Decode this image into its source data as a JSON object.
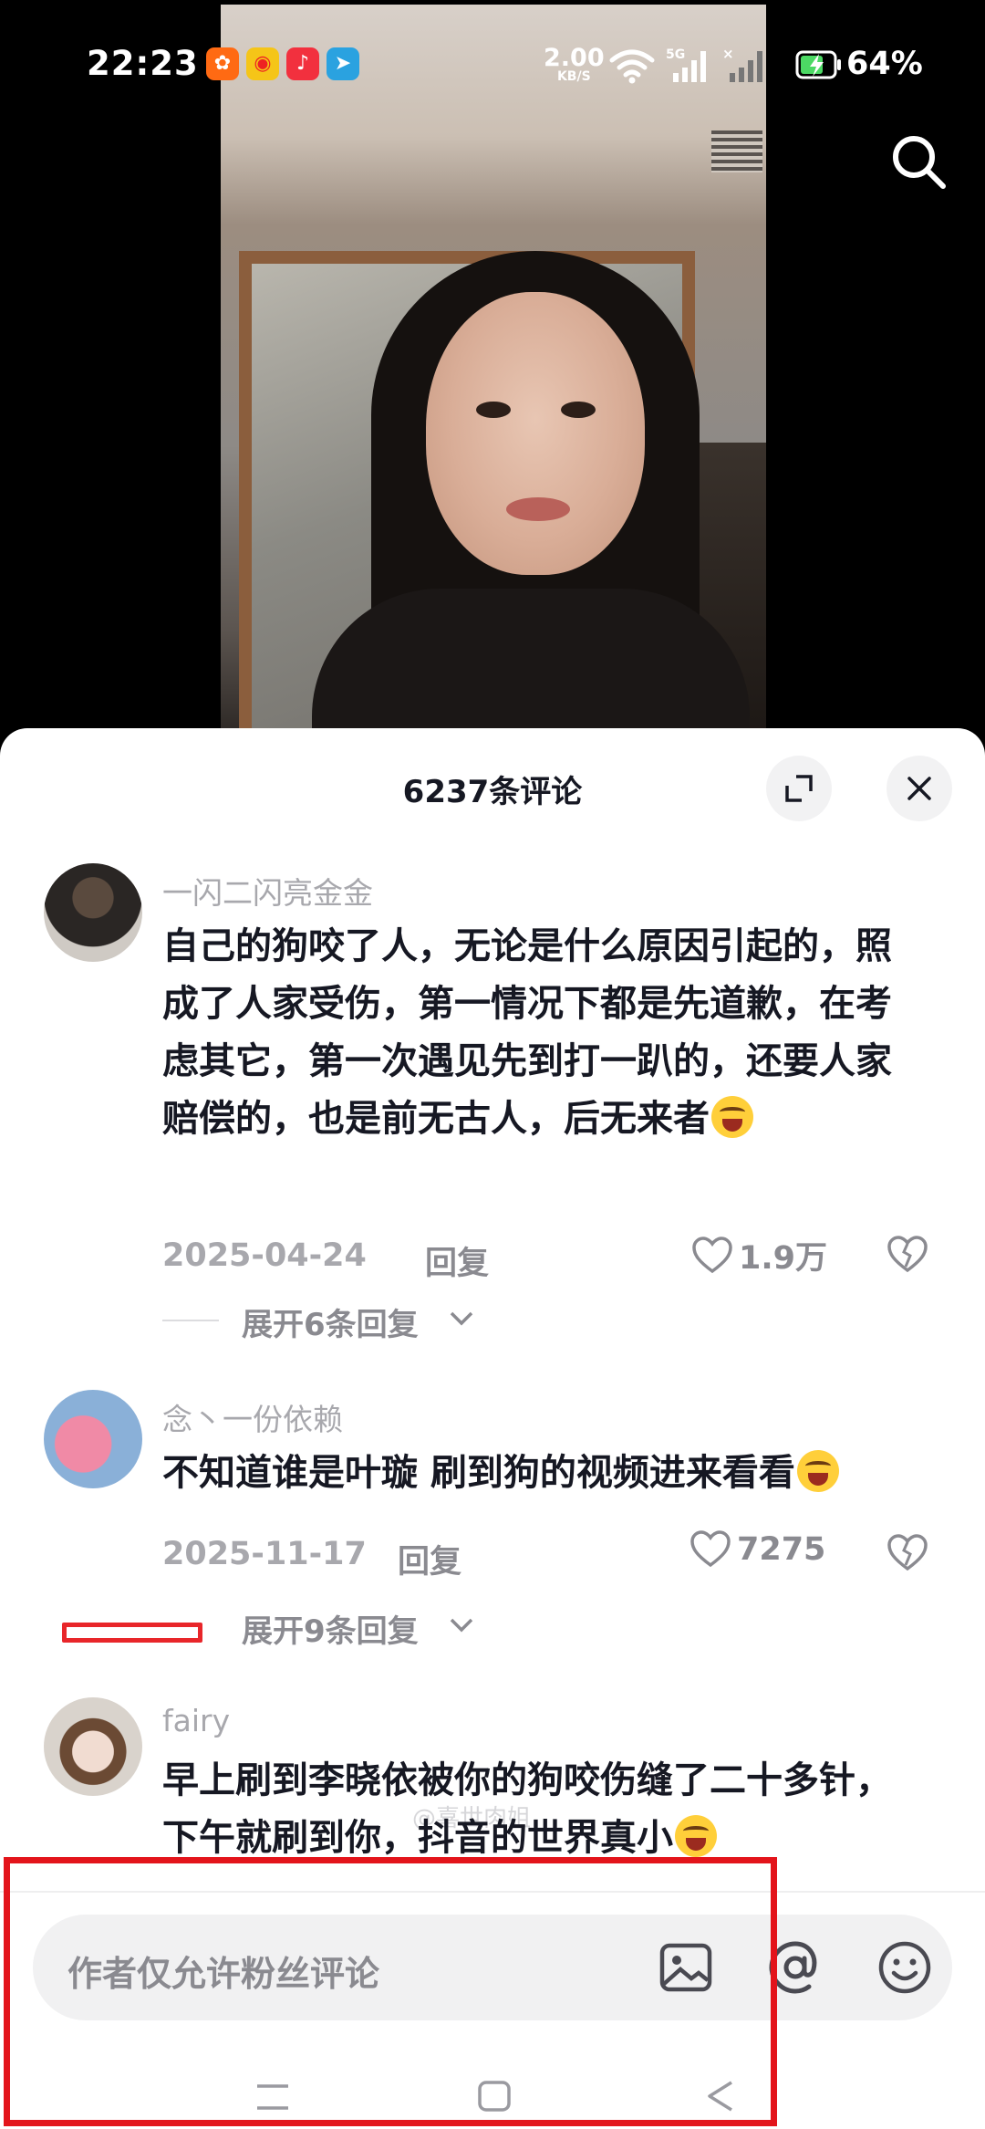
{
  "status_bar": {
    "time": "22:23",
    "net_speed_value": "2.00",
    "net_speed_unit": "KB/S",
    "network_type": "5G",
    "battery_percent": "64%",
    "app_icons": [
      "taobao-icon",
      "weibo-icon",
      "music-icon",
      "telegram-icon"
    ]
  },
  "comments_panel": {
    "title": "6237条评论",
    "watermark": "@喜世肉姐",
    "comments": [
      {
        "username": "一闪二闪亮金金",
        "text": "自己的狗咬了人，无论是什么原因引起的，照成了人家受伤，第一情况下都是先道歉，在考虑其它，第一次遇见先到打一趴的，还要人家赔偿的，也是前无古人，后无来者",
        "date": "2025-04-24",
        "reply_label": "回复",
        "likes": "1.9万",
        "expand_label": "展开6条回复"
      },
      {
        "username": "念丶一份依赖",
        "text": "不知道谁是叶璇 刷到狗的视频进来看看",
        "date": "2025-11-17",
        "reply_label": "回复",
        "likes": "7275",
        "expand_label": "展开9条回复"
      },
      {
        "username": "fairy",
        "text": "早上刷到李晓依被你的狗咬伤缝了二十多针，下午就刷到你，抖音的世界真小"
      }
    ]
  },
  "input_bar": {
    "placeholder": "作者仅允许粉丝评论"
  },
  "colors": {
    "highlight_red": "#e3141b",
    "text_primary": "#161823",
    "text_secondary": "#a8a8ad"
  }
}
